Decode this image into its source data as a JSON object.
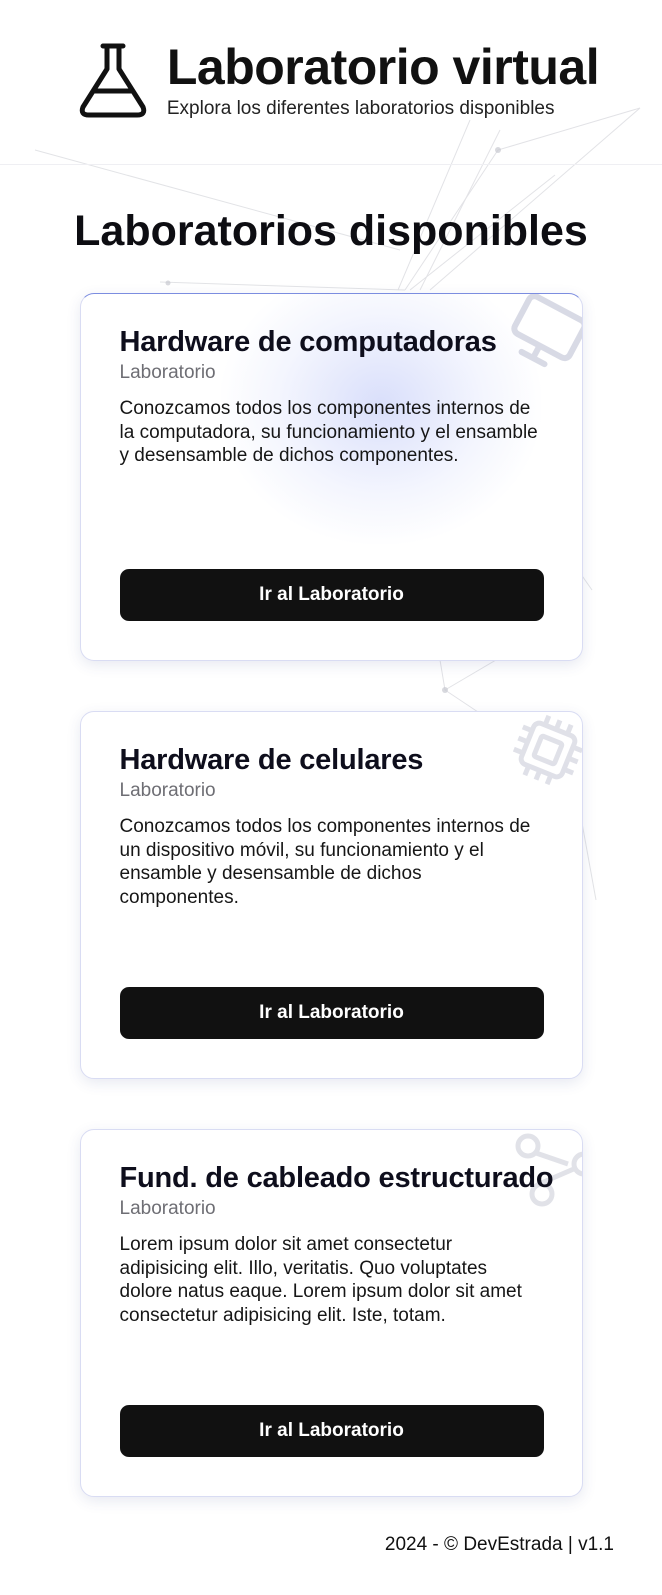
{
  "header": {
    "title": "Laboratorio virtual",
    "subtitle": "Explora los diferentes laboratorios disponibles",
    "icon": "flask-icon"
  },
  "section": {
    "title": "Laboratorios disponibles"
  },
  "cards": [
    {
      "title": "Hardware de computadoras",
      "type": "Laboratorio",
      "description": "Conozcamos todos los componentes internos de la computadora, su funcionamiento y el ensamble y desensamble de dichos componentes.",
      "button_label": "Ir al Laboratorio",
      "icon": "monitor-icon"
    },
    {
      "title": "Hardware de celulares",
      "type": "Laboratorio",
      "description": "Conozcamos todos los componentes internos de un dispositivo móvil, su funcionamiento y el ensamble y desensamble de dichos componentes.",
      "button_label": "Ir al Laboratorio",
      "icon": "chip-icon"
    },
    {
      "title": "Fund. de cableado estructurado",
      "type": "Laboratorio",
      "description": "Lorem ipsum dolor sit amet consectetur adipisicing elit. Illo, veritatis. Quo voluptates dolore natus eaque. Lorem ipsum dolor sit amet consectetur adipisicing elit. Iste, totam.",
      "button_label": "Ir al Laboratorio",
      "icon": "network-icon"
    }
  ],
  "footer": {
    "text": "2024 - © DevEstrada | v1.1"
  },
  "colors": {
    "button_bg": "#111111",
    "card_border": "#d9dcf3",
    "accent_glow": "#7c8de0"
  }
}
